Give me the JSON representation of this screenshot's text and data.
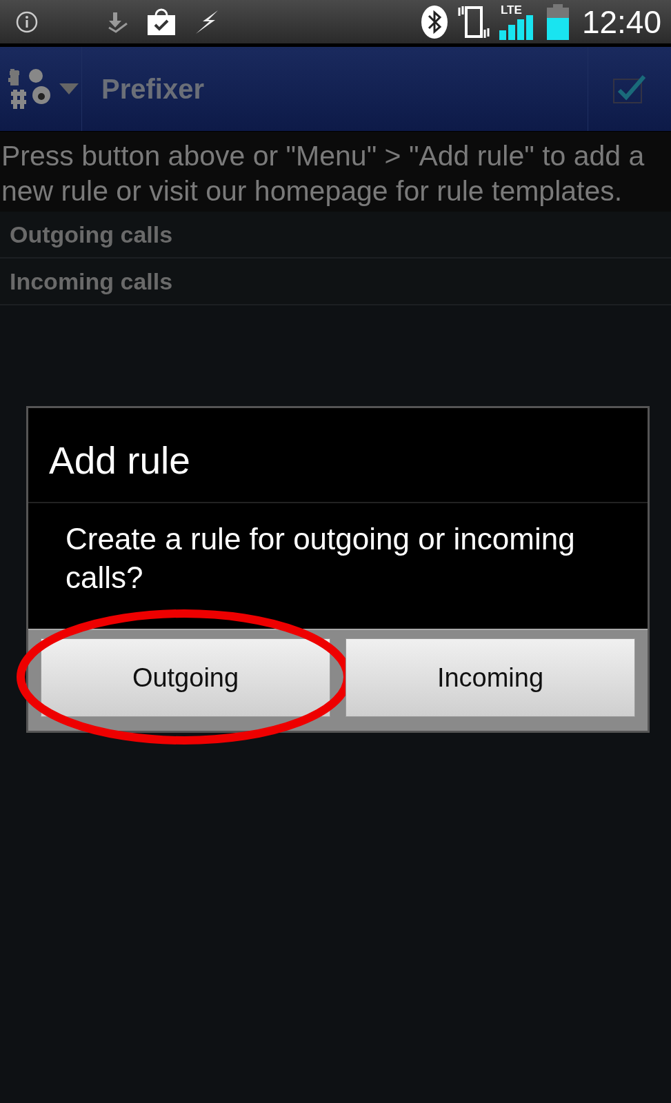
{
  "status_bar": {
    "time": "12:40",
    "network": "LTE"
  },
  "app_bar": {
    "title": "Prefixer"
  },
  "hint": "Press button above or \"Menu\" > \"Add rule\" to add a new rule or visit our homepage for rule templates.",
  "sections": [
    {
      "label": "Outgoing calls"
    },
    {
      "label": "Incoming calls"
    }
  ],
  "dialog": {
    "title": "Add rule",
    "message": "Create a rule for outgoing or incoming calls?",
    "buttons": [
      {
        "label": "Outgoing",
        "circled": true
      },
      {
        "label": "Incoming",
        "circled": false
      }
    ]
  }
}
